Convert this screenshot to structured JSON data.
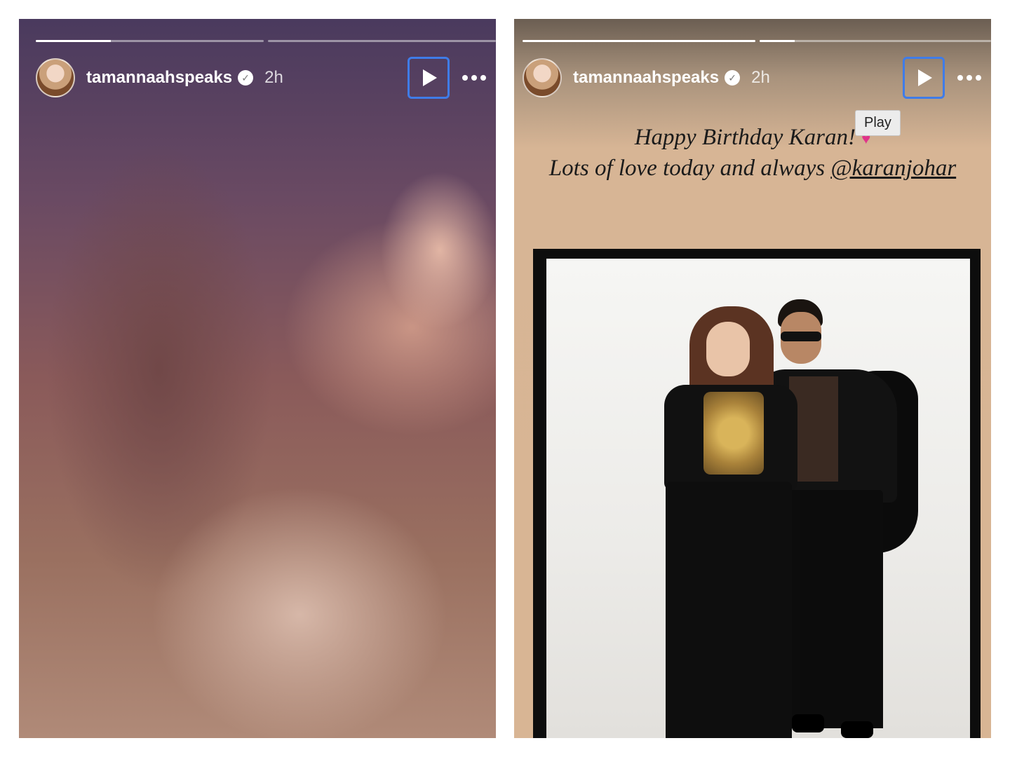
{
  "stories": [
    {
      "username": "tamannaahspeaks",
      "time": "2h",
      "progress": [
        0.33,
        0.0
      ],
      "play_icon": "play-icon",
      "more_icon": "ellipsis-icon",
      "verified_icon": "verified-badge-icon",
      "verified_glyph": "✓"
    },
    {
      "username": "tamannaahspeaks",
      "time": "2h",
      "progress": [
        1.0,
        0.15
      ],
      "play_icon": "play-icon",
      "more_icon": "ellipsis-icon",
      "verified_icon": "verified-badge-icon",
      "verified_glyph": "✓",
      "tooltip": "Play",
      "caption_line1": "Happy Birthday Karan!",
      "heart_glyph": "♥",
      "caption_line2": "Lots of love today and always",
      "mention": "@karanjohar"
    }
  ],
  "colors": {
    "focus_outline": "#3f7ce8",
    "story2_bg": "#d8b594",
    "heart": "#e0338a"
  }
}
